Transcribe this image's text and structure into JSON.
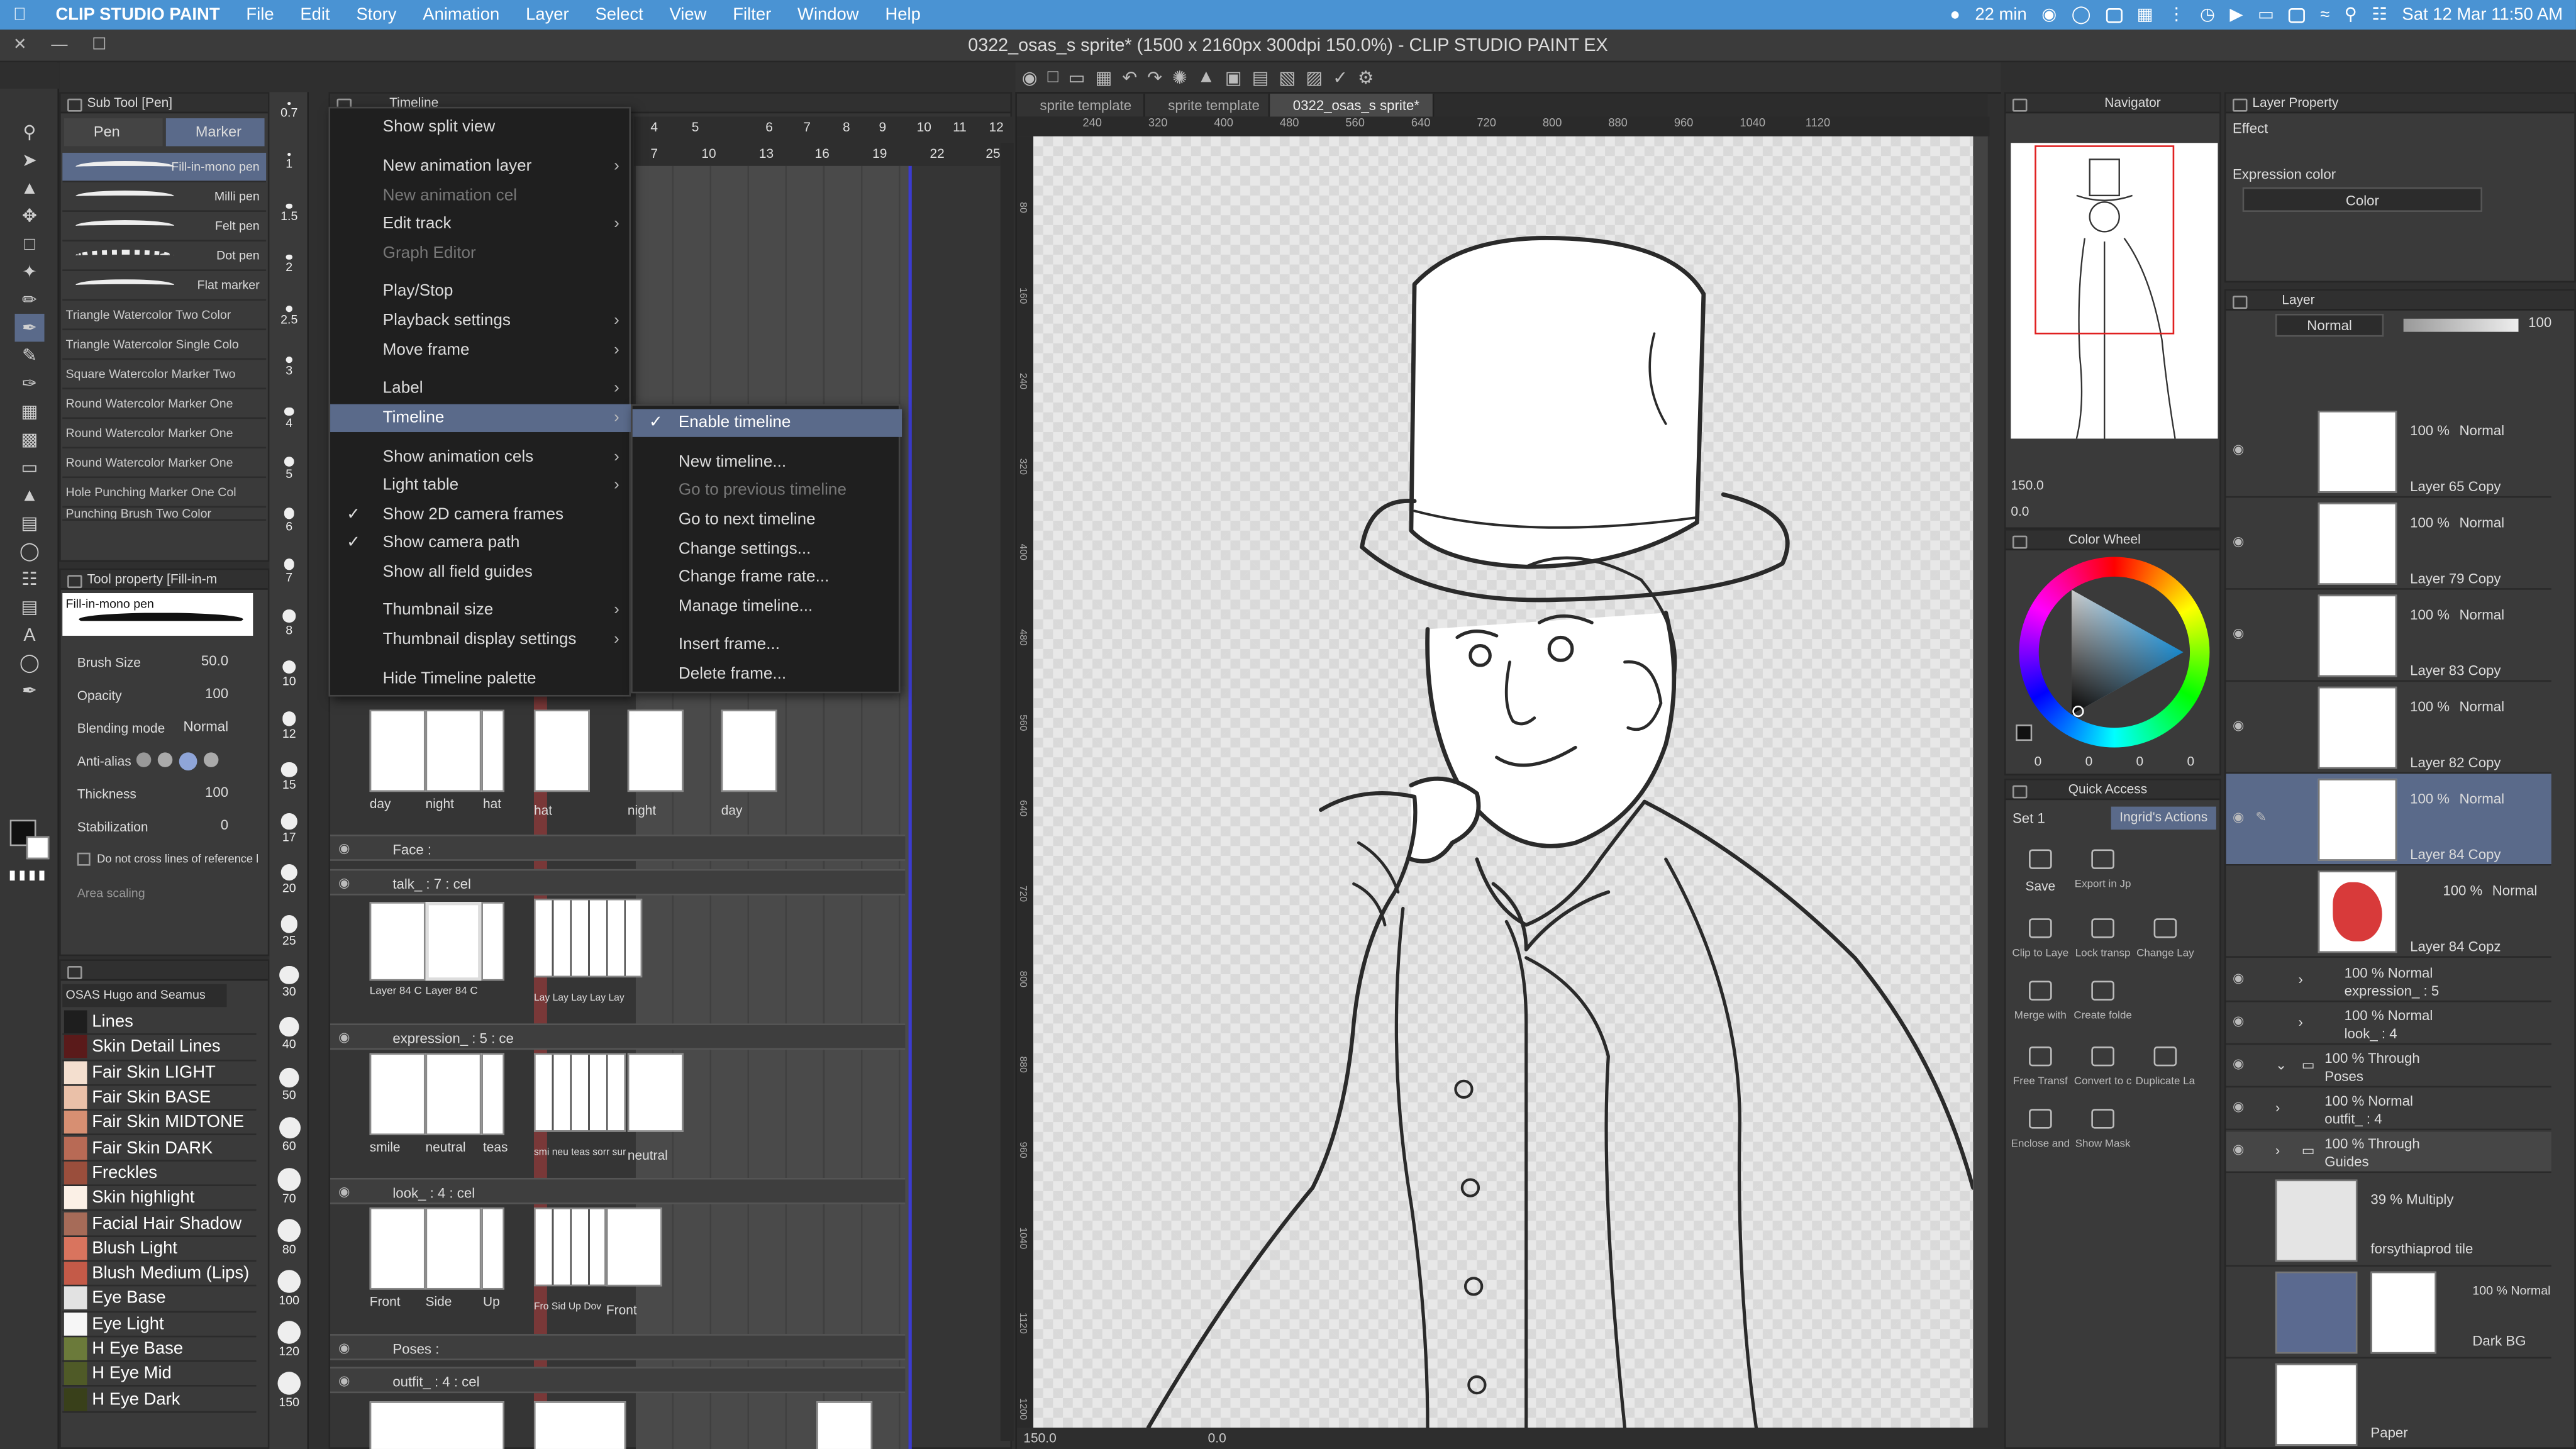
{
  "menubar": {
    "app": "CLIP STUDIO PAINT",
    "items": [
      "File",
      "Edit",
      "Story",
      "Animation",
      "Layer",
      "Select",
      "View",
      "Filter",
      "Window",
      "Help"
    ],
    "battery_time": "22 min",
    "datetime": "Sat 12 Mar  11:50 AM"
  },
  "window": {
    "title": "0322_osas_s sprite* (1500 x 2160px 300dpi 150.0%) - CLIP STUDIO PAINT EX"
  },
  "subtool": {
    "header": "Sub Tool [Pen]",
    "tabs": [
      "Pen",
      "Marker"
    ],
    "brushes": [
      "Fill-in-mono pen",
      "Milli pen",
      "Felt pen",
      "Dot pen",
      "Flat marker"
    ],
    "list": [
      "Triangle Watercolor Two Color",
      "Triangle Watercolor Single Colo",
      "Square Watercolor Marker Two",
      "Round Watercolor Marker One",
      "Round Watercolor Marker One",
      "Round Watercolor Marker One",
      "Hole Punching Marker One Col",
      "Punching Brush Two Color"
    ]
  },
  "toolprop": {
    "header": "Tool property [Fill-in-m",
    "preset": "Fill-in-mono pen",
    "brush_size_label": "Brush Size",
    "brush_size": "50.0",
    "opacity_label": "Opacity",
    "opacity": "100",
    "blend_label": "Blending mode",
    "blend": "Normal",
    "aa_label": "Anti-alias",
    "thickness_label": "Thickness",
    "thickness": "100",
    "stab_label": "Stabilization",
    "stab": "0",
    "no_cross": "Do not cross lines of reference l",
    "area_scaling": "Area scaling"
  },
  "colorset": {
    "name": "OSAS Hugo and Seamus",
    "items": [
      {
        "label": "Lines",
        "color": "#1e1e1e"
      },
      {
        "label": "Skin Detail Lines",
        "color": "#5a1a1a"
      },
      {
        "label": "Fair Skin LIGHT",
        "color": "#f4dfcf"
      },
      {
        "label": "Fair Skin BASE",
        "color": "#eac0a8"
      },
      {
        "label": "Fair Skin MIDTONE",
        "color": "#d78f72"
      },
      {
        "label": "Fair Skin DARK",
        "color": "#b86a55"
      },
      {
        "label": "Freckles",
        "color": "#9a4e3c"
      },
      {
        "label": "Skin highlight",
        "color": "#fbf0e6"
      },
      {
        "label": "Facial Hair Shadow",
        "color": "#a66b58"
      },
      {
        "label": "Blush Light",
        "color": "#d9745e"
      },
      {
        "label": "Blush Medium (Lips)",
        "color": "#c45a48"
      },
      {
        "label": "Eye Base",
        "color": "#e2e2e2"
      },
      {
        "label": "Eye Light",
        "color": "#f6f6f6"
      },
      {
        "label": "H Eye Base",
        "color": "#6b7a3a"
      },
      {
        "label": "H Eye Mid",
        "color": "#4f5a27"
      },
      {
        "label": "H Eye Dark",
        "color": "#39401a"
      }
    ]
  },
  "sizes": [
    "0.7",
    "1",
    "1.5",
    "2",
    "2.5",
    "3",
    "4",
    "5",
    "6",
    "7",
    "8",
    "10",
    "12",
    "15",
    "17",
    "20",
    "25",
    "30",
    "40",
    "50",
    "60",
    "70",
    "80",
    "100",
    "120",
    "150"
  ],
  "timeline": {
    "header": "Timeline",
    "frames": [
      "4",
      "7",
      "6",
      "10",
      "13",
      "16",
      "8",
      "19",
      "22",
      "25"
    ],
    "frames_top": [
      "4",
      "5",
      "6",
      "7",
      "8",
      "9",
      "10",
      "11",
      "12"
    ],
    "rows": [
      {
        "label": "Face :"
      },
      {
        "label": "talk_ : 7 : cel"
      },
      {
        "label": "expression_ : 5 : ce"
      },
      {
        "label": "look_ : 4 : cel"
      },
      {
        "label": "Poses :"
      },
      {
        "label": "outfit_ : 4 : cel"
      }
    ],
    "cel_labels_a": [
      "day",
      "night",
      "hat"
    ],
    "cel_labels_b": [
      "hat",
      "night",
      "day"
    ],
    "talk_labels": [
      "Layer 84 C",
      "Layer 84 C"
    ],
    "talk_right": "Lay Lay Lay Lay Lay",
    "expr_labels": [
      "smile",
      "neutral",
      "teas"
    ],
    "expr_right": "smi neu teas sorr sur",
    "expr_right2": "neutral",
    "look_labels": [
      "Front",
      "Side",
      "Up"
    ],
    "look_right": "Fro Sid Up Dov",
    "look_right2": "Front"
  },
  "menu": {
    "items": [
      "Show split view",
      "New animation layer",
      "New animation cel",
      "Edit track",
      "Graph Editor",
      "Play/Stop",
      "Playback settings",
      "Move frame",
      "Label",
      "Timeline",
      "Show animation cels",
      "Light table",
      "Show 2D camera frames",
      "Show camera path",
      "Show all field guides",
      "Thumbnail size",
      "Thumbnail display settings",
      "Hide Timeline palette"
    ]
  },
  "submenu": {
    "items": [
      "Enable timeline",
      "New timeline...",
      "Go to previous timeline",
      "Go to next timeline",
      "Change settings...",
      "Change frame rate...",
      "Manage timeline...",
      "Insert frame...",
      "Delete frame..."
    ]
  },
  "canvas": {
    "tabs": [
      "sprite template",
      "sprite template",
      "0322_osas_s sprite*"
    ],
    "ruler_top": [
      "240",
      "320",
      "400",
      "480",
      "560",
      "640",
      "720",
      "800",
      "880",
      "960",
      "1040",
      "1120"
    ],
    "ruler_left": [
      "80",
      "160",
      "240",
      "320",
      "400",
      "480",
      "560",
      "640",
      "720",
      "800",
      "880",
      "960",
      "1040",
      "1120",
      "1200"
    ],
    "zoom": "150.0",
    "angle": "0.0"
  },
  "navigator": {
    "header": "Navigator",
    "zoom": "150.0",
    "angle": "0.0"
  },
  "colorwheel": {
    "header": "Color Wheel",
    "values": [
      "0",
      "0",
      "0",
      "0"
    ]
  },
  "quickaccess": {
    "header": "Quick Access",
    "set": "Set 1",
    "tab": "Ingrid's Actions",
    "buttons": [
      "Save",
      "Export in Jp",
      "Clip to Laye",
      "Lock transp",
      "Change Lay",
      "Merge with",
      "Create folde",
      "Free Transf",
      "Convert to c",
      "Duplicate La",
      "Enclose and",
      "Show Mask"
    ]
  },
  "layerprop": {
    "header": "Layer Property",
    "effect": "Effect",
    "expr_label": "Expression color",
    "expr": "Color"
  },
  "layers": {
    "header": "Layer",
    "blend": "Normal",
    "opacity": "100",
    "items": [
      {
        "pct": "100 %",
        "mode": "Normal",
        "name": "Layer 65 Copy"
      },
      {
        "pct": "100 %",
        "mode": "Normal",
        "name": "Layer 79 Copy"
      },
      {
        "pct": "100 %",
        "mode": "Normal",
        "name": "Layer 83 Copy"
      },
      {
        "pct": "100 %",
        "mode": "Normal",
        "name": "Layer 82 Copy"
      },
      {
        "pct": "100 %",
        "mode": "Normal",
        "name": "Layer 84 Copy"
      },
      {
        "pct": "100 %",
        "mode": "Normal",
        "name": "Layer 84 Copz"
      }
    ],
    "folders": [
      {
        "line1": "100 % Normal",
        "line2": "expression_ : 5"
      },
      {
        "line1": "100 % Normal",
        "line2": "look_ : 4"
      },
      {
        "line1": "100 % Through",
        "line2": "Poses"
      },
      {
        "line1": "100 % Normal",
        "line2": "outfit_ : 4"
      },
      {
        "line1": "100 % Through",
        "line2": "Guides"
      }
    ],
    "bottom": [
      {
        "line1": "39 % Multiply",
        "name": "forsythiaprod tile"
      },
      {
        "line1": "100 % Normal",
        "name": "Dark BG"
      },
      {
        "name": "Paper"
      }
    ]
  }
}
